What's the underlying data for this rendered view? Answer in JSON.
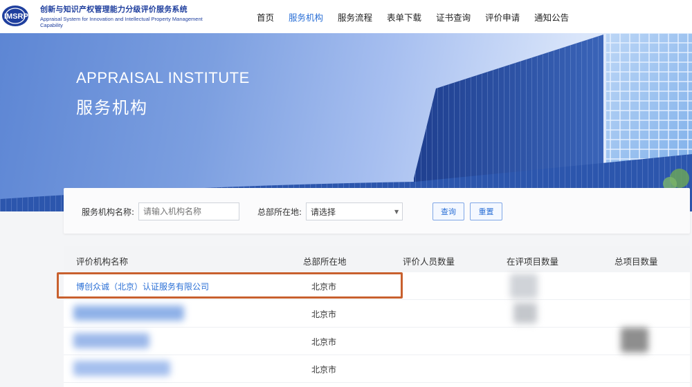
{
  "header": {
    "logo_text": "IMSRP",
    "title_cn": "创新与知识产权管理能力分级评价服务系统",
    "title_en": "Appraisal System for Innovation and Intellectual Property Management Capability",
    "nav": [
      "首页",
      "服务机构",
      "服务流程",
      "表单下载",
      "证书查询",
      "评价申请",
      "通知公告"
    ],
    "active_nav": "服务机构"
  },
  "banner": {
    "title_en": "APPRAISAL INSTITUTE",
    "title_cn": "服务机构"
  },
  "search": {
    "name_label": "服务机构名称:",
    "name_placeholder": "请输入机构名称",
    "location_label": "总部所在地:",
    "location_value": "请选择",
    "query_button": "查询",
    "reset_button": "重置"
  },
  "table": {
    "columns": [
      "评价机构名称",
      "总部所在地",
      "评价人员数量",
      "在评项目数量",
      "总项目数量"
    ],
    "rows": [
      {
        "name": "博创众诚（北京）认证服务有限公司",
        "location": "北京市"
      },
      {
        "name": "",
        "location": "北京市"
      },
      {
        "name": "",
        "location": "北京市"
      },
      {
        "name": "",
        "location": "北京市"
      }
    ]
  },
  "colors": {
    "accent": "#2a6fd6",
    "brand": "#1f3f9e",
    "highlight_border": "#c8602e"
  }
}
